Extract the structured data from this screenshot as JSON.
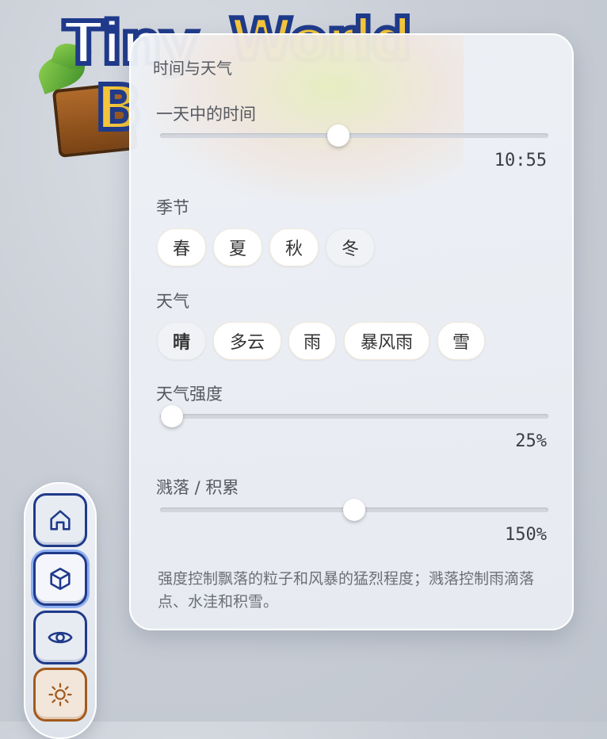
{
  "panel": {
    "title": "时间与天气",
    "time": {
      "label": "一天中的时间",
      "value": "10:55",
      "fraction": 0.46
    },
    "season": {
      "label": "季节",
      "options": [
        "春",
        "夏",
        "秋",
        "冬"
      ],
      "selected": "冬"
    },
    "weather": {
      "label": "天气",
      "options": [
        "晴",
        "多云",
        "雨",
        "暴风雨",
        "雪"
      ],
      "selected": "晴"
    },
    "intensity": {
      "label": "天气强度",
      "value": "25%",
      "fraction": 0.03
    },
    "splash": {
      "label": "溅落 / 积累",
      "value": "150%",
      "fraction": 0.5
    },
    "note": "强度控制飘落的粒子和风暴的猛烈程度；溅落控制雨滴落点、水洼和积雪。"
  },
  "nav": {
    "items": [
      "home-icon",
      "cube-icon",
      "eye-icon",
      "sun-icon"
    ],
    "selected": "cube-icon"
  },
  "colors": {
    "nav_border": "#1f3a8a",
    "sun_border": "#a35a1c"
  }
}
